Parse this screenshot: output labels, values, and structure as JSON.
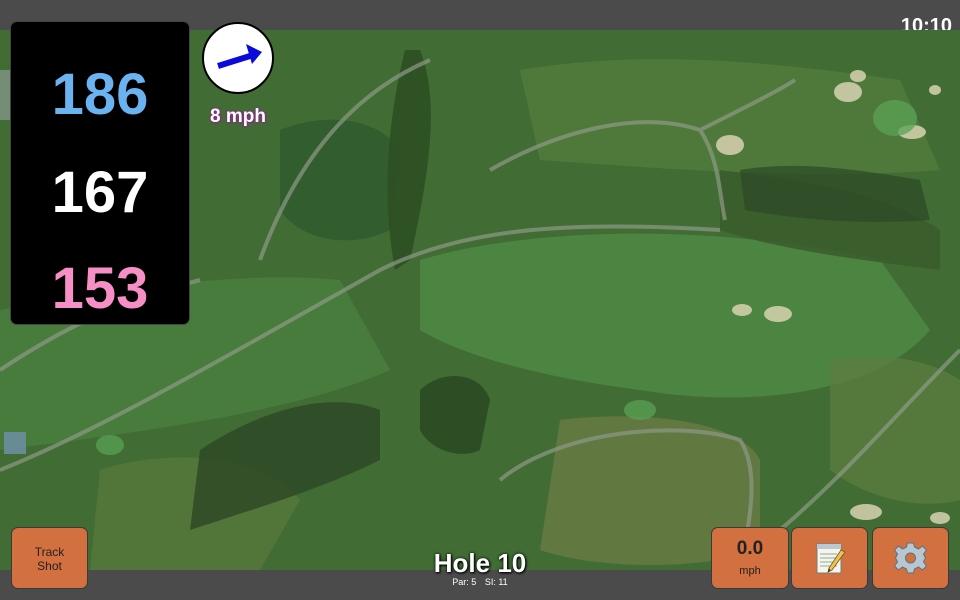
{
  "status": {
    "time": "10:10"
  },
  "distances": {
    "back": "186",
    "middle": "167",
    "front": "153"
  },
  "wind": {
    "speed_label": "8 mph",
    "direction": "arrow-right-up-icon"
  },
  "hole": {
    "title": "Hole 10",
    "par": "Par: 5",
    "si": "SI: 11"
  },
  "buttons": {
    "track_shot_line1": "Track",
    "track_shot_line2": "Shot",
    "wind_value": "0.0",
    "wind_unit": "mph",
    "notes_icon": "notepad-icon",
    "settings_icon": "gear-icon"
  },
  "colors": {
    "back_distance": "#6bb2f1",
    "middle_distance": "#ffffff",
    "front_distance": "#f78fc6",
    "button": "#d2703f",
    "wind_label_glow": "#8a2a8a"
  }
}
